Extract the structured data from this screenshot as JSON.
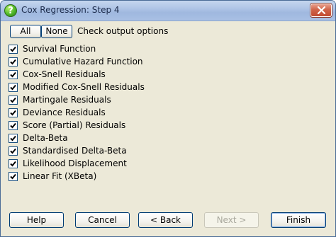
{
  "window": {
    "title": "Cox Regression: Step 4",
    "help_icon_glyph": "?",
    "close_glyph": "✕"
  },
  "toolbar": {
    "all_label": "All",
    "none_label": "None",
    "check_label": "Check output options"
  },
  "options": [
    {
      "label": "Survival Function",
      "checked": true
    },
    {
      "label": "Cumulative Hazard Function",
      "checked": true
    },
    {
      "label": "Cox-Snell Residuals",
      "checked": true
    },
    {
      "label": "Modified Cox-Snell Residuals",
      "checked": true
    },
    {
      "label": "Martingale Residuals",
      "checked": true
    },
    {
      "label": "Deviance Residuals",
      "checked": true
    },
    {
      "label": "Score (Partial) Residuals",
      "checked": true
    },
    {
      "label": "Delta-Beta",
      "checked": true
    },
    {
      "label": "Standardised Delta-Beta",
      "checked": true
    },
    {
      "label": "Likelihood Displacement",
      "checked": true
    },
    {
      "label": "Linear Fit (XBeta)",
      "checked": true
    }
  ],
  "buttons": {
    "help_label": "Help",
    "cancel_label": "Cancel",
    "back_label": "< Back",
    "next_label": "Next >",
    "finish_label": "Finish"
  },
  "colors": {
    "dialog_bg": "#ece9d8",
    "title_bar": "#aec4e6",
    "check_mark": "#000000"
  }
}
